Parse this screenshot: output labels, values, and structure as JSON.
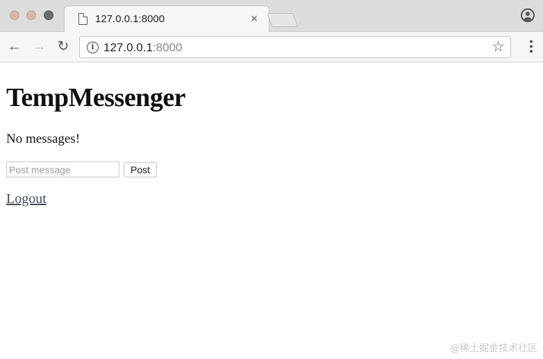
{
  "window": {
    "tab_title": "127.0.0.1:8000",
    "tab_close": "×",
    "favicon_icon": "document-icon",
    "profile_icon": "account-circle-icon"
  },
  "toolbar": {
    "back_glyph": "←",
    "forward_glyph": "→",
    "reload_glyph": "↻",
    "url_host": "127.0.0.1",
    "url_port": ":8000",
    "info_glyph": "i",
    "star_glyph": "☆"
  },
  "page": {
    "heading": "TempMessenger",
    "empty_message": "No messages!",
    "post_placeholder": "Post message",
    "post_button": "Post",
    "logout_link": "Logout"
  },
  "watermark": "@稀土掘金技术社区",
  "colors": {
    "tabstrip_bg": "#dcdcdc",
    "toolbar_bg": "#f6f6f6",
    "link": "#444a55"
  }
}
